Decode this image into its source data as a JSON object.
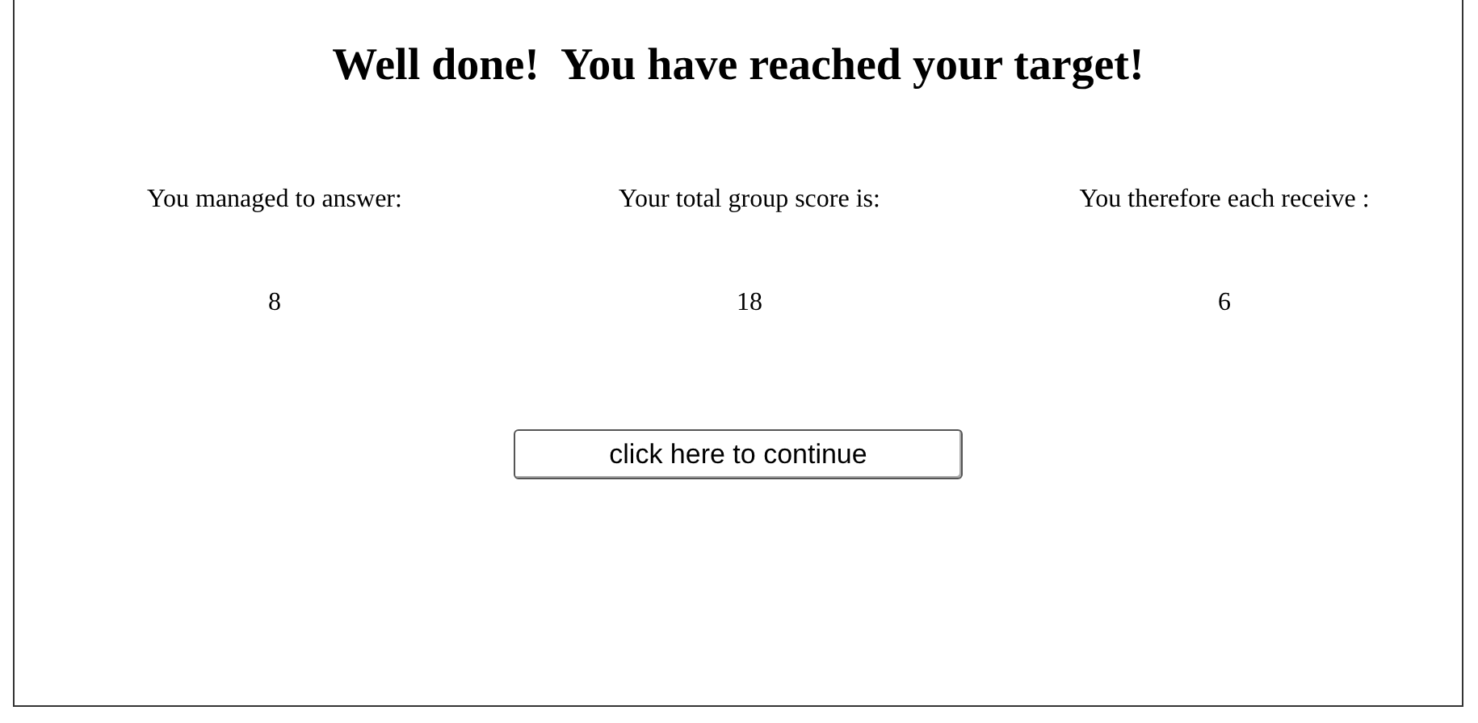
{
  "title": "Well done!  You have reached your target!",
  "results": [
    {
      "label": "You managed to answer:",
      "value": "8"
    },
    {
      "label": "Your total group score is:",
      "value": "18"
    },
    {
      "label": "You therefore each receive :",
      "value": "6"
    }
  ],
  "button": {
    "label": "click here to continue"
  }
}
